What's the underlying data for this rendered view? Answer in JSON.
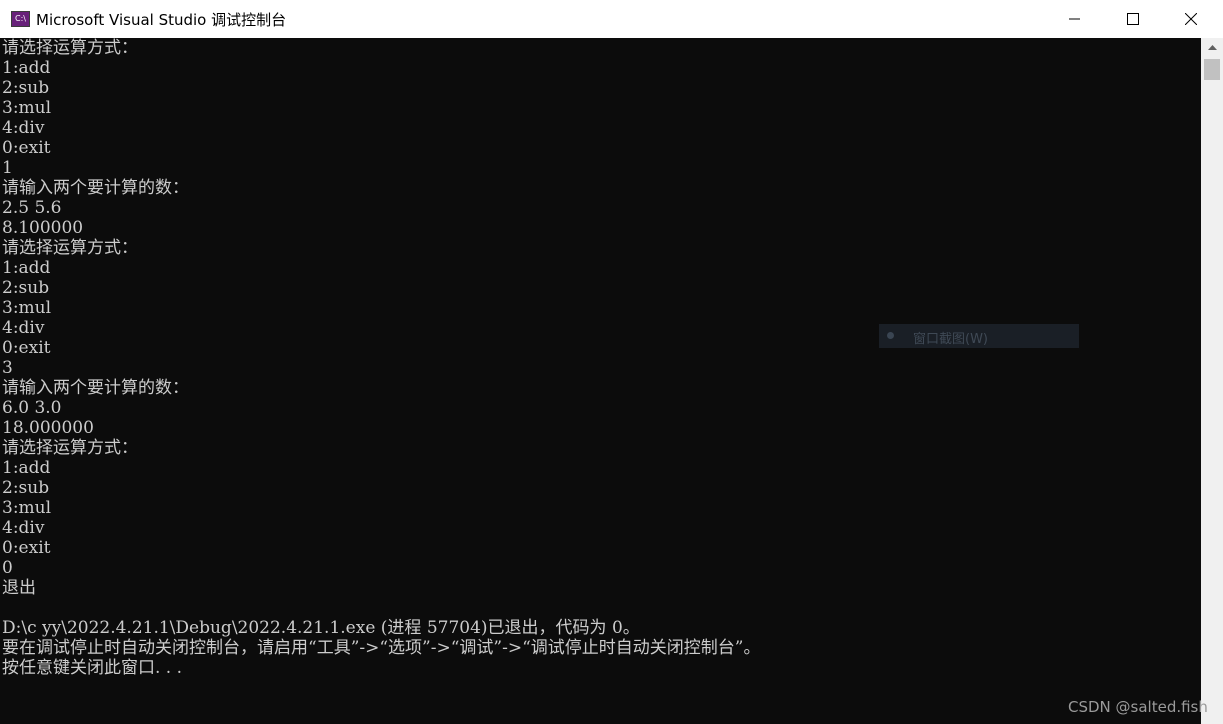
{
  "window": {
    "icon_text": "C:\\",
    "title": "Microsoft Visual Studio 调试控制台"
  },
  "console_lines": [
    "请选择运算方式：",
    "1:add",
    "2:sub",
    "3:mul",
    "4:div",
    "0:exit",
    "1",
    "请输入两个要计算的数：",
    "2.5 5.6",
    "8.100000",
    "请选择运算方式：",
    "1:add",
    "2:sub",
    "3:mul",
    "4:div",
    "0:exit",
    "3",
    "请输入两个要计算的数：",
    "6.0 3.0",
    "18.000000",
    "请选择运算方式：",
    "1:add",
    "2:sub",
    "3:mul",
    "4:div",
    "0:exit",
    "0",
    "退出",
    "",
    "D:\\c yy\\2022.4.21.1\\Debug\\2022.4.21.1.exe (进程 57704)已退出，代码为 0。",
    "要在调试停止时自动关闭控制台，请启用“工具”->“选项”->“调试”->“调试停止时自动关闭控制台”。",
    "按任意键关闭此窗口. . ."
  ],
  "overlay": {
    "label": "窗口截图(W)"
  },
  "watermark": "CSDN @salted.fish",
  "colors": {
    "console_bg": "#0c0c0c",
    "console_text": "#cccccc",
    "titlebar_bg": "#ffffff",
    "scrollbar_bg": "#f0f0f0"
  },
  "icons": {
    "minimize": "minimize-icon",
    "maximize": "maximize-icon",
    "close": "close-icon",
    "scroll_up": "arrow-up-icon"
  }
}
